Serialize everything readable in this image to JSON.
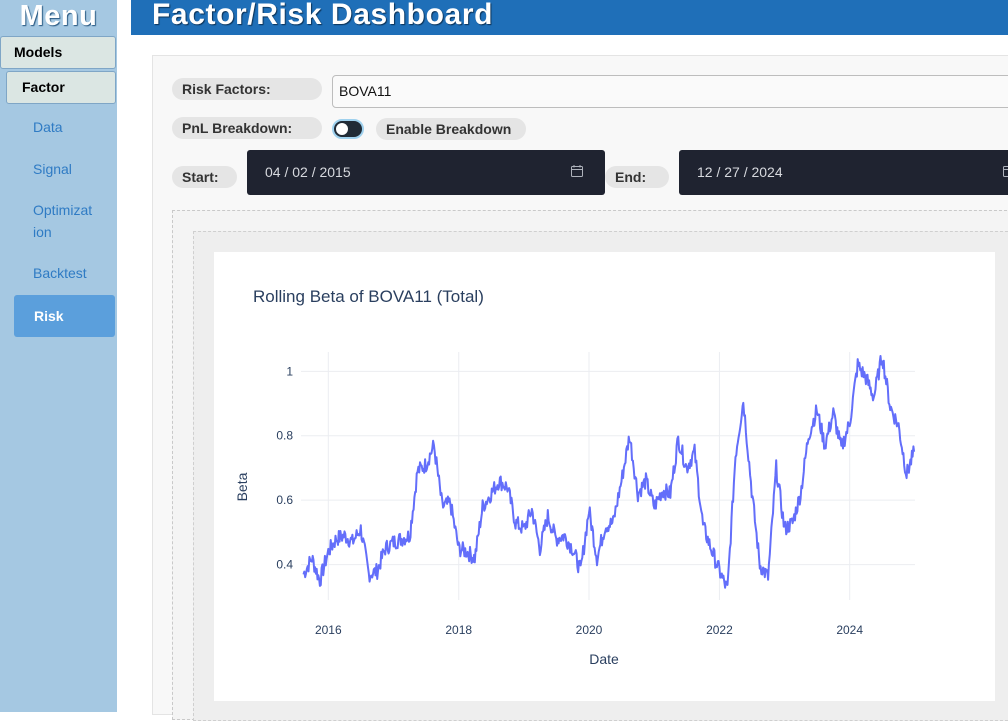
{
  "sidebar": {
    "title": "Menu",
    "group": "Models",
    "subgroup": "Factor",
    "items": [
      {
        "label": "Data"
      },
      {
        "label": "Signal"
      },
      {
        "label": "Optimizat\nion"
      },
      {
        "label": "Backtest"
      },
      {
        "label": "Risk",
        "active": true
      }
    ]
  },
  "header": {
    "title": "Factor/Risk Dashboard"
  },
  "controls": {
    "risk_factors_label": "Risk Factors:",
    "risk_factors_value": "BOVA11",
    "pnl_label": "PnL Breakdown:",
    "pnl_toggle_on": false,
    "pnl_toggle_label": "Enable Breakdown",
    "start_label": "Start:",
    "start_date": "04 / 02 / 2015",
    "end_label": "End:",
    "end_date": "12 / 27 / 2024",
    "calendar_icon": "calendar-icon"
  },
  "colors": {
    "sidebar_bg": "#a5c8e2",
    "header_bg": "#1f6fb8",
    "active_nav": "#5b9fdc",
    "line": "#636efa"
  },
  "chart_data": {
    "type": "line",
    "title": "Rolling Beta of BOVA11 (Total)",
    "xlabel": "Date",
    "ylabel": "Beta",
    "xlim": [
      "2015-08-01",
      "2025-01-01"
    ],
    "ylim": [
      0.29,
      1.06
    ],
    "x_ticks": [
      "2016",
      "2018",
      "2020",
      "2022",
      "2024"
    ],
    "y_ticks": [
      "0.4",
      "0.6",
      "0.8",
      "1"
    ],
    "grid": true,
    "series": [
      {
        "x": [
          "2015-08-15",
          "2015-10-01",
          "2015-11-15",
          "2016-01-01",
          "2016-02-15",
          "2016-04-01",
          "2016-05-15",
          "2016-07-01",
          "2016-08-15",
          "2016-10-01",
          "2016-11-15",
          "2017-01-01",
          "2017-02-15",
          "2017-04-01",
          "2017-05-15",
          "2017-07-01",
          "2017-08-15",
          "2017-10-01",
          "2017-11-15",
          "2018-01-01",
          "2018-02-15",
          "2018-04-01",
          "2018-05-15",
          "2018-07-01",
          "2018-08-15",
          "2018-10-01",
          "2018-11-15",
          "2019-01-01",
          "2019-02-15",
          "2019-04-01",
          "2019-05-15",
          "2019-07-01",
          "2019-08-15",
          "2019-10-01",
          "2019-11-15",
          "2020-01-01",
          "2020-02-15",
          "2020-04-01",
          "2020-05-15",
          "2020-07-01",
          "2020-08-15",
          "2020-10-01",
          "2020-11-15",
          "2021-01-01",
          "2021-02-15",
          "2021-04-01",
          "2021-05-15",
          "2021-07-01",
          "2021-08-15",
          "2021-10-01",
          "2021-11-15",
          "2022-01-01",
          "2022-02-15",
          "2022-04-01",
          "2022-05-15",
          "2022-07-01",
          "2022-08-15",
          "2022-10-01",
          "2022-11-15",
          "2023-01-01",
          "2023-02-15",
          "2023-04-01",
          "2023-05-15",
          "2023-07-01",
          "2023-08-15",
          "2023-10-01",
          "2023-11-15",
          "2024-01-01",
          "2024-02-15",
          "2024-04-01",
          "2024-05-15",
          "2024-07-01",
          "2024-08-15",
          "2024-10-01",
          "2024-11-15",
          "2024-12-27"
        ],
        "values": [
          0.37,
          0.42,
          0.35,
          0.44,
          0.48,
          0.49,
          0.47,
          0.51,
          0.37,
          0.38,
          0.45,
          0.47,
          0.48,
          0.49,
          0.69,
          0.71,
          0.77,
          0.58,
          0.59,
          0.45,
          0.44,
          0.42,
          0.58,
          0.62,
          0.66,
          0.64,
          0.53,
          0.51,
          0.57,
          0.45,
          0.55,
          0.48,
          0.49,
          0.45,
          0.38,
          0.57,
          0.42,
          0.52,
          0.53,
          0.66,
          0.8,
          0.62,
          0.66,
          0.58,
          0.63,
          0.62,
          0.79,
          0.7,
          0.75,
          0.52,
          0.45,
          0.38,
          0.32,
          0.74,
          0.91,
          0.63,
          0.4,
          0.36,
          0.7,
          0.51,
          0.53,
          0.62,
          0.8,
          0.88,
          0.77,
          0.87,
          0.76,
          0.84,
          1.02,
          0.98,
          0.92,
          1.05,
          0.89,
          0.83,
          0.68,
          0.75
        ]
      }
    ]
  }
}
